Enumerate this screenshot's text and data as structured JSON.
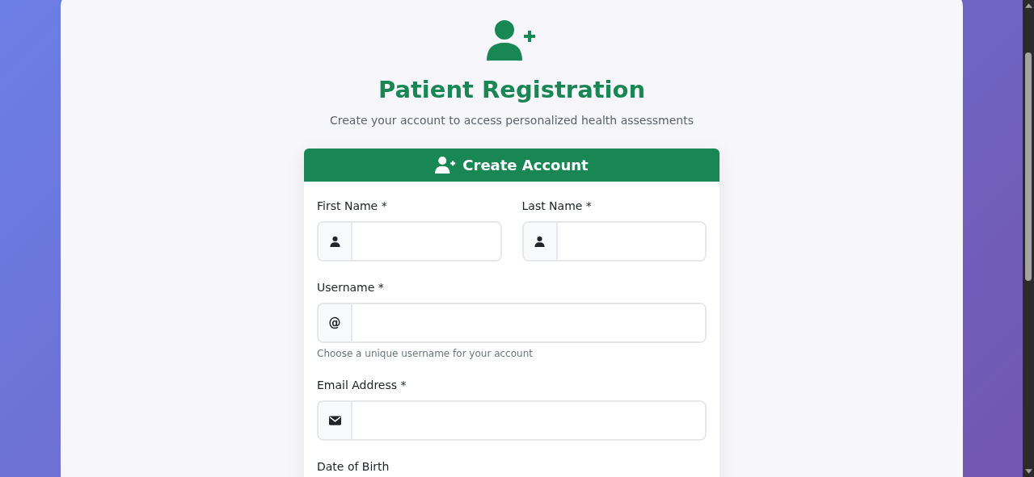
{
  "header": {
    "title": "Patient Registration",
    "subtitle": "Create your account to access personalized health assessments"
  },
  "form": {
    "title": "Create Account",
    "rows": [
      [
        {
          "kind": "name",
          "label": "First Name *"
        },
        {
          "kind": "name",
          "label": "Last Name *"
        }
      ],
      [
        {
          "kind": "username",
          "label": "Username *",
          "addon": "@",
          "help": "Choose a unique username for your account"
        }
      ],
      [
        {
          "kind": "email",
          "label": "Email Address *"
        }
      ],
      [
        {
          "kind": "date",
          "label": "Date of Birth"
        }
      ]
    ]
  }
}
